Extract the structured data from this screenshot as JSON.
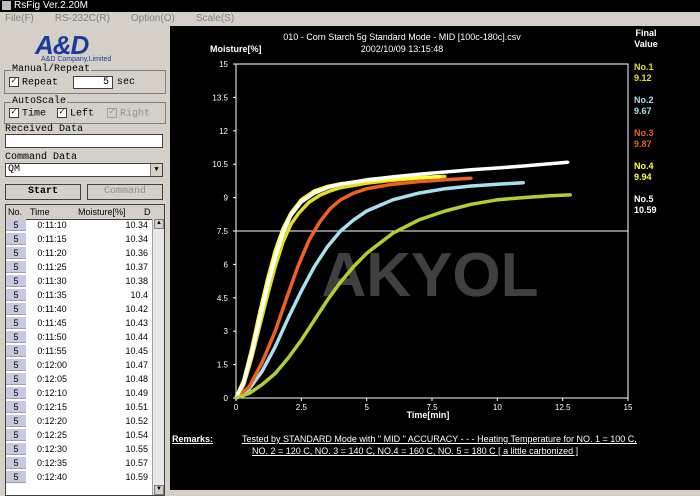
{
  "window": {
    "title": "RsFig Ver.2.20M"
  },
  "menu": [
    "File(F)",
    "RS-232C(R)",
    "Option(O)",
    "Scale(S)"
  ],
  "logo": {
    "brand": "A&D",
    "sub": "A&D Company,Limited"
  },
  "manual_repeat": {
    "title": "Manual/Repeat",
    "repeat_label": "Repeat",
    "repeat_checked": true,
    "interval": "5",
    "unit": "sec"
  },
  "autoscale": {
    "title": "AutoScale",
    "time": "Time",
    "left": "Left",
    "right": "Right"
  },
  "received": {
    "label": "Received Data",
    "value": ""
  },
  "command": {
    "label": "Command Data",
    "value": "QM",
    "start": "Start",
    "command_btn": "Command"
  },
  "table": {
    "headers": [
      "No.",
      "Time",
      "Moisture[%]",
      "D"
    ],
    "rows": [
      [
        "5",
        "0:11:10",
        "10.34"
      ],
      [
        "5",
        "0:11:15",
        "10.34"
      ],
      [
        "5",
        "0:11:20",
        "10.36"
      ],
      [
        "5",
        "0:11:25",
        "10.37"
      ],
      [
        "5",
        "0:11:30",
        "10.38"
      ],
      [
        "5",
        "0:11:35",
        "10.4"
      ],
      [
        "5",
        "0:11:40",
        "10.42"
      ],
      [
        "5",
        "0:11:45",
        "10.43"
      ],
      [
        "5",
        "0:11:50",
        "10.44"
      ],
      [
        "5",
        "0:11:55",
        "10.45"
      ],
      [
        "5",
        "0:12:00",
        "10.47"
      ],
      [
        "5",
        "0:12:05",
        "10.48"
      ],
      [
        "5",
        "0:12:10",
        "10.49"
      ],
      [
        "5",
        "0:12:15",
        "10.51"
      ],
      [
        "5",
        "0:12:20",
        "10.52"
      ],
      [
        "5",
        "0:12:25",
        "10.54"
      ],
      [
        "5",
        "0:12:30",
        "10.55"
      ],
      [
        "5",
        "0:12:35",
        "10.57"
      ],
      [
        "5",
        "0:12:40",
        "10.59"
      ]
    ]
  },
  "chart_data": {
    "type": "line",
    "title": "010 - Corn Starch 5g Standard Mode - MID [100c-180c].csv",
    "subtitle": "2002/10/09  13:15:48",
    "ylabel": "Moisture[%]",
    "xlabel": "Time[min]",
    "xlim": [
      0,
      15
    ],
    "ylim": [
      0,
      15
    ],
    "xticks": [
      "0",
      "2.5",
      "5",
      "7.5",
      "10",
      "12.5",
      "15"
    ],
    "yticks": [
      "15",
      "13.5",
      "12",
      "10.5",
      "9",
      "7.5",
      "6",
      "4.5",
      "3",
      "1.5",
      "0"
    ],
    "final_label": "Final Value",
    "series": [
      {
        "name": "No.1",
        "final": "9.12",
        "color": "#e0e020",
        "x": [
          0,
          0.3,
          0.6,
          0.9,
          1.2,
          1.5,
          1.8,
          2.1,
          2.4,
          2.8,
          3.2,
          3.6,
          4,
          4.5,
          5,
          5.5,
          6,
          6.5,
          7,
          7.5,
          8
        ],
        "y": [
          0,
          0.6,
          1.8,
          3.2,
          4.6,
          5.9,
          7,
          7.8,
          8.3,
          8.8,
          9.1,
          9.3,
          9.45,
          9.55,
          9.65,
          9.72,
          9.78,
          9.83,
          9.88,
          9.92,
          9.95
        ]
      },
      {
        "name": "No.2",
        "final": "9.67",
        "color": "#a8e0f0",
        "x": [
          0,
          0.5,
          1,
          1.5,
          2,
          2.5,
          3,
          3.5,
          4,
          4.5,
          5,
          6,
          7,
          8,
          9,
          10,
          11
        ],
        "y": [
          0,
          0.4,
          1.2,
          2.3,
          3.6,
          4.8,
          5.9,
          6.8,
          7.5,
          8,
          8.4,
          8.9,
          9.2,
          9.4,
          9.52,
          9.6,
          9.67
        ]
      },
      {
        "name": "No.3",
        "final": "9.87",
        "color": "#f06020",
        "x": [
          0,
          0.5,
          1,
          1.5,
          2,
          2.4,
          2.8,
          3.2,
          3.6,
          4,
          4.5,
          5,
          6,
          7,
          8,
          9
        ],
        "y": [
          0,
          0.5,
          1.6,
          3,
          4.7,
          6,
          7.1,
          7.9,
          8.5,
          8.9,
          9.2,
          9.4,
          9.6,
          9.72,
          9.8,
          9.87
        ]
      },
      {
        "name": "No.4",
        "final": "9.94",
        "color": "#ffff40",
        "x": [
          0,
          0.3,
          0.6,
          0.9,
          1.2,
          1.5,
          1.8,
          2.1,
          2.5,
          3,
          3.5,
          4,
          5,
          6,
          7,
          7.8
        ],
        "y": [
          0,
          0.8,
          2.2,
          3.8,
          5.3,
          6.6,
          7.6,
          8.3,
          8.9,
          9.3,
          9.5,
          9.62,
          9.75,
          9.84,
          9.9,
          9.94
        ]
      },
      {
        "name": "No.5",
        "final": "10.59",
        "color": "#ffffff",
        "x": [
          0,
          0.3,
          0.6,
          0.9,
          1.2,
          1.5,
          1.8,
          2.1,
          2.5,
          3,
          3.5,
          4,
          5,
          6,
          7,
          8,
          9,
          10,
          11,
          12,
          12.7
        ],
        "y": [
          0,
          0.7,
          2,
          3.5,
          5,
          6.3,
          7.4,
          8.2,
          8.8,
          9.2,
          9.45,
          9.6,
          9.8,
          9.93,
          10.05,
          10.15,
          10.25,
          10.33,
          10.42,
          10.52,
          10.59
        ]
      },
      {
        "name": "",
        "final": "",
        "color": "#b0d030",
        "x": [
          0,
          0.5,
          1,
          1.5,
          2,
          2.5,
          3,
          3.5,
          4,
          4.5,
          5,
          6,
          7,
          8,
          9,
          10,
          11,
          12,
          12.8
        ],
        "y": [
          0,
          0.2,
          0.6,
          1.1,
          1.8,
          2.6,
          3.5,
          4.4,
          5.2,
          5.9,
          6.5,
          7.4,
          8,
          8.4,
          8.7,
          8.9,
          9,
          9.08,
          9.12
        ]
      }
    ]
  },
  "remarks": {
    "label": "Remarks:",
    "line1": "Tested by STANDARD Mode  with \" MID \" ACCURACY - - - Heating Temperature   for   NO. 1 =  100 C,",
    "line2": "NO. 2 = 120 C,  NO. 3 = 140 C,  NO.4  = 160 C,  NO. 5 = 180 C  [ a little carbonized ]"
  },
  "watermark": "AKYOL"
}
